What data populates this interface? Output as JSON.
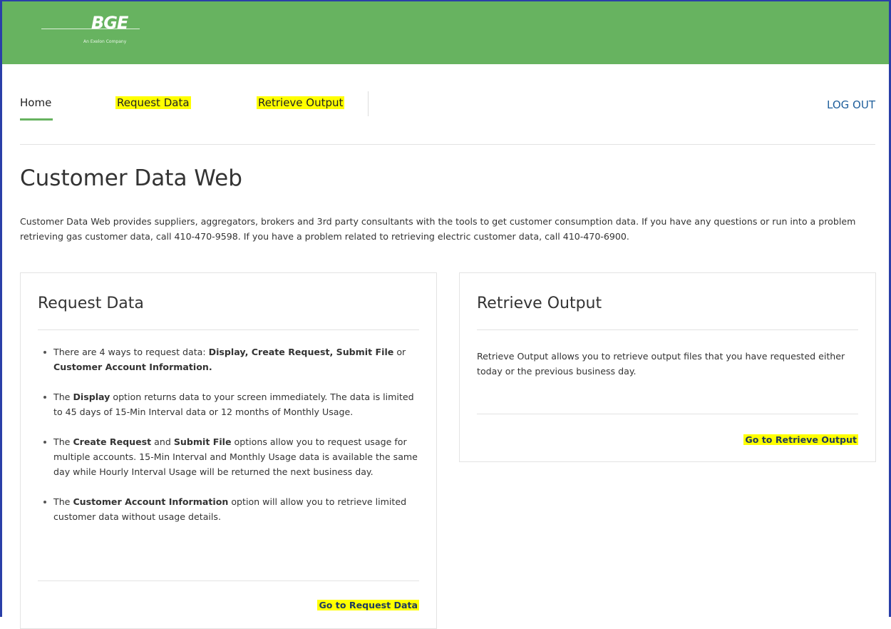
{
  "header": {
    "logo_text": "BGE",
    "logo_subtext": "An Exelon Company"
  },
  "nav": {
    "home": "Home",
    "request_data": "Request Data",
    "retrieve_output": "Retrieve Output",
    "logout": "LOG OUT"
  },
  "page": {
    "title": "Customer Data Web",
    "intro": "Customer Data Web provides suppliers, aggregators, brokers and 3rd party consultants with the tools to get customer consumption data. If you have any questions or run into a problem retrieving gas customer data, call 410-470-9598. If you have a problem related to retrieving electric customer data, call 410-470-6900."
  },
  "request_card": {
    "title": "Request Data",
    "bullet1": {
      "pre": "There are 4 ways to request data: ",
      "b1": "Display, Create Request, Submit File",
      "mid": " or ",
      "b2": "Customer Account Information."
    },
    "bullet2": {
      "pre": "The ",
      "b1": "Display",
      "post": " option returns data to your screen immediately. The data is limited to 45 days of 15-Min Interval data or 12 months of Monthly Usage."
    },
    "bullet3": {
      "pre": "The ",
      "b1": "Create Request",
      "mid": " and ",
      "b2": "Submit File",
      "post": " options allow you to request usage for multiple accounts. 15-Min Interval and Monthly Usage data is available the same day while Hourly Interval Usage will be returned the next business day."
    },
    "bullet4": {
      "pre": "The ",
      "b1": "Customer Account Information",
      "post": " option will allow you to retrieve limited customer data without usage details."
    },
    "link": "Go to Request Data"
  },
  "retrieve_card": {
    "title": "Retrieve Output",
    "text": "Retrieve Output allows you to retrieve output files that you have requested either today or the previous business day.",
    "link": "Go to Retrieve Output"
  },
  "colors": {
    "header_green": "#67b360",
    "highlight": "#ffff00",
    "link_blue": "#1f5f9c"
  }
}
